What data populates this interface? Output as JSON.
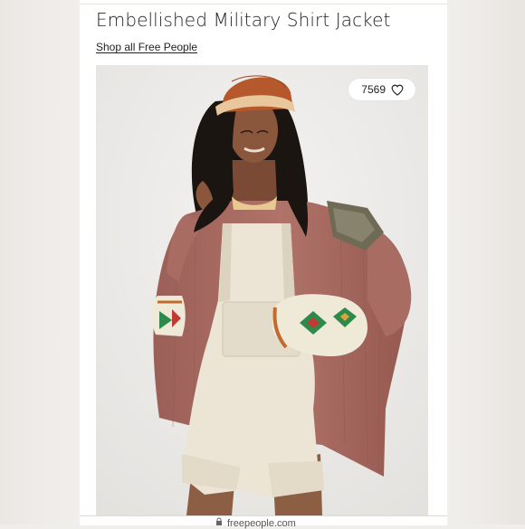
{
  "product": {
    "title": "Embellished Military Shirt Jacket",
    "shop_link": "Shop all Free People"
  },
  "favorites": {
    "count": "7569",
    "icon": "heart-outline-icon"
  },
  "footer": {
    "url": "freepeople.com",
    "icon": "lock-icon"
  },
  "colors": {
    "page_background": "#f0eeeb",
    "card": "#ffffff",
    "title_text": "#1f1f1f",
    "jacket": "#a66b62",
    "overalls": "#ebe3d3",
    "hat": "#b5582c"
  }
}
